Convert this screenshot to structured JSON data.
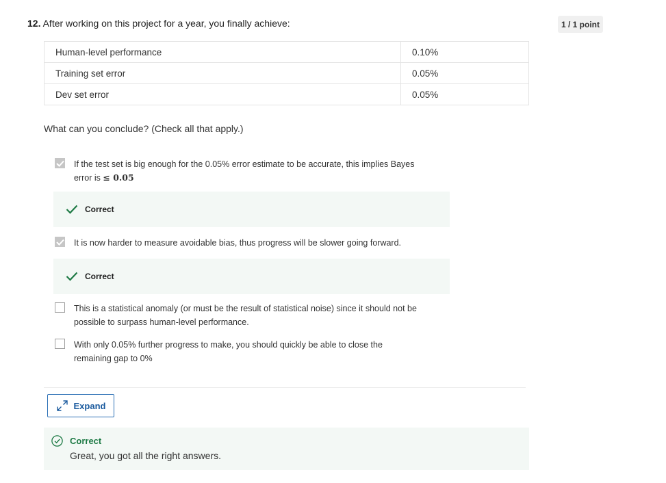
{
  "question": {
    "number": "12.",
    "text": "After working on this project for a year, you finally achieve:",
    "points": "1 / 1 point"
  },
  "table": {
    "rows": [
      {
        "label": "Human-level performance",
        "value": "0.10%"
      },
      {
        "label": "Training set error",
        "value": "0.05%"
      },
      {
        "label": "Dev set error",
        "value": "0.05%"
      }
    ]
  },
  "prompt": "What can you conclude? (Check all that apply.)",
  "options": [
    {
      "line1": "If the test set is big enough for the 0.05% error estimate to be accurate, this implies Bayes",
      "line2_prefix": "error is ",
      "line2_math": "≤ 0.05",
      "checked": true,
      "feedback": "Correct"
    },
    {
      "line1": "It is now harder to measure avoidable bias, thus progress will be slower going forward.",
      "checked": true,
      "feedback": "Correct"
    },
    {
      "line1": "This is a statistical anomaly (or must be the result of statistical noise) since it should not be",
      "line2": "possible to surpass human-level performance.",
      "checked": false
    },
    {
      "line1": "With only 0.05% further progress to make, you should quickly be able to close the",
      "line2": "remaining gap to 0%",
      "checked": false
    }
  ],
  "expand_button": {
    "label": "Expand",
    "icon": "expand-arrows-icon"
  },
  "result": {
    "title": "Correct",
    "message": "Great, you got all the right answers.",
    "icon": "check-circle-icon"
  },
  "colors": {
    "correct_green": "#1e7a45",
    "feedback_bg": "#f3f8f5",
    "link_blue": "#1a5a9e",
    "checkbox_checked": "#c6c6c6"
  }
}
